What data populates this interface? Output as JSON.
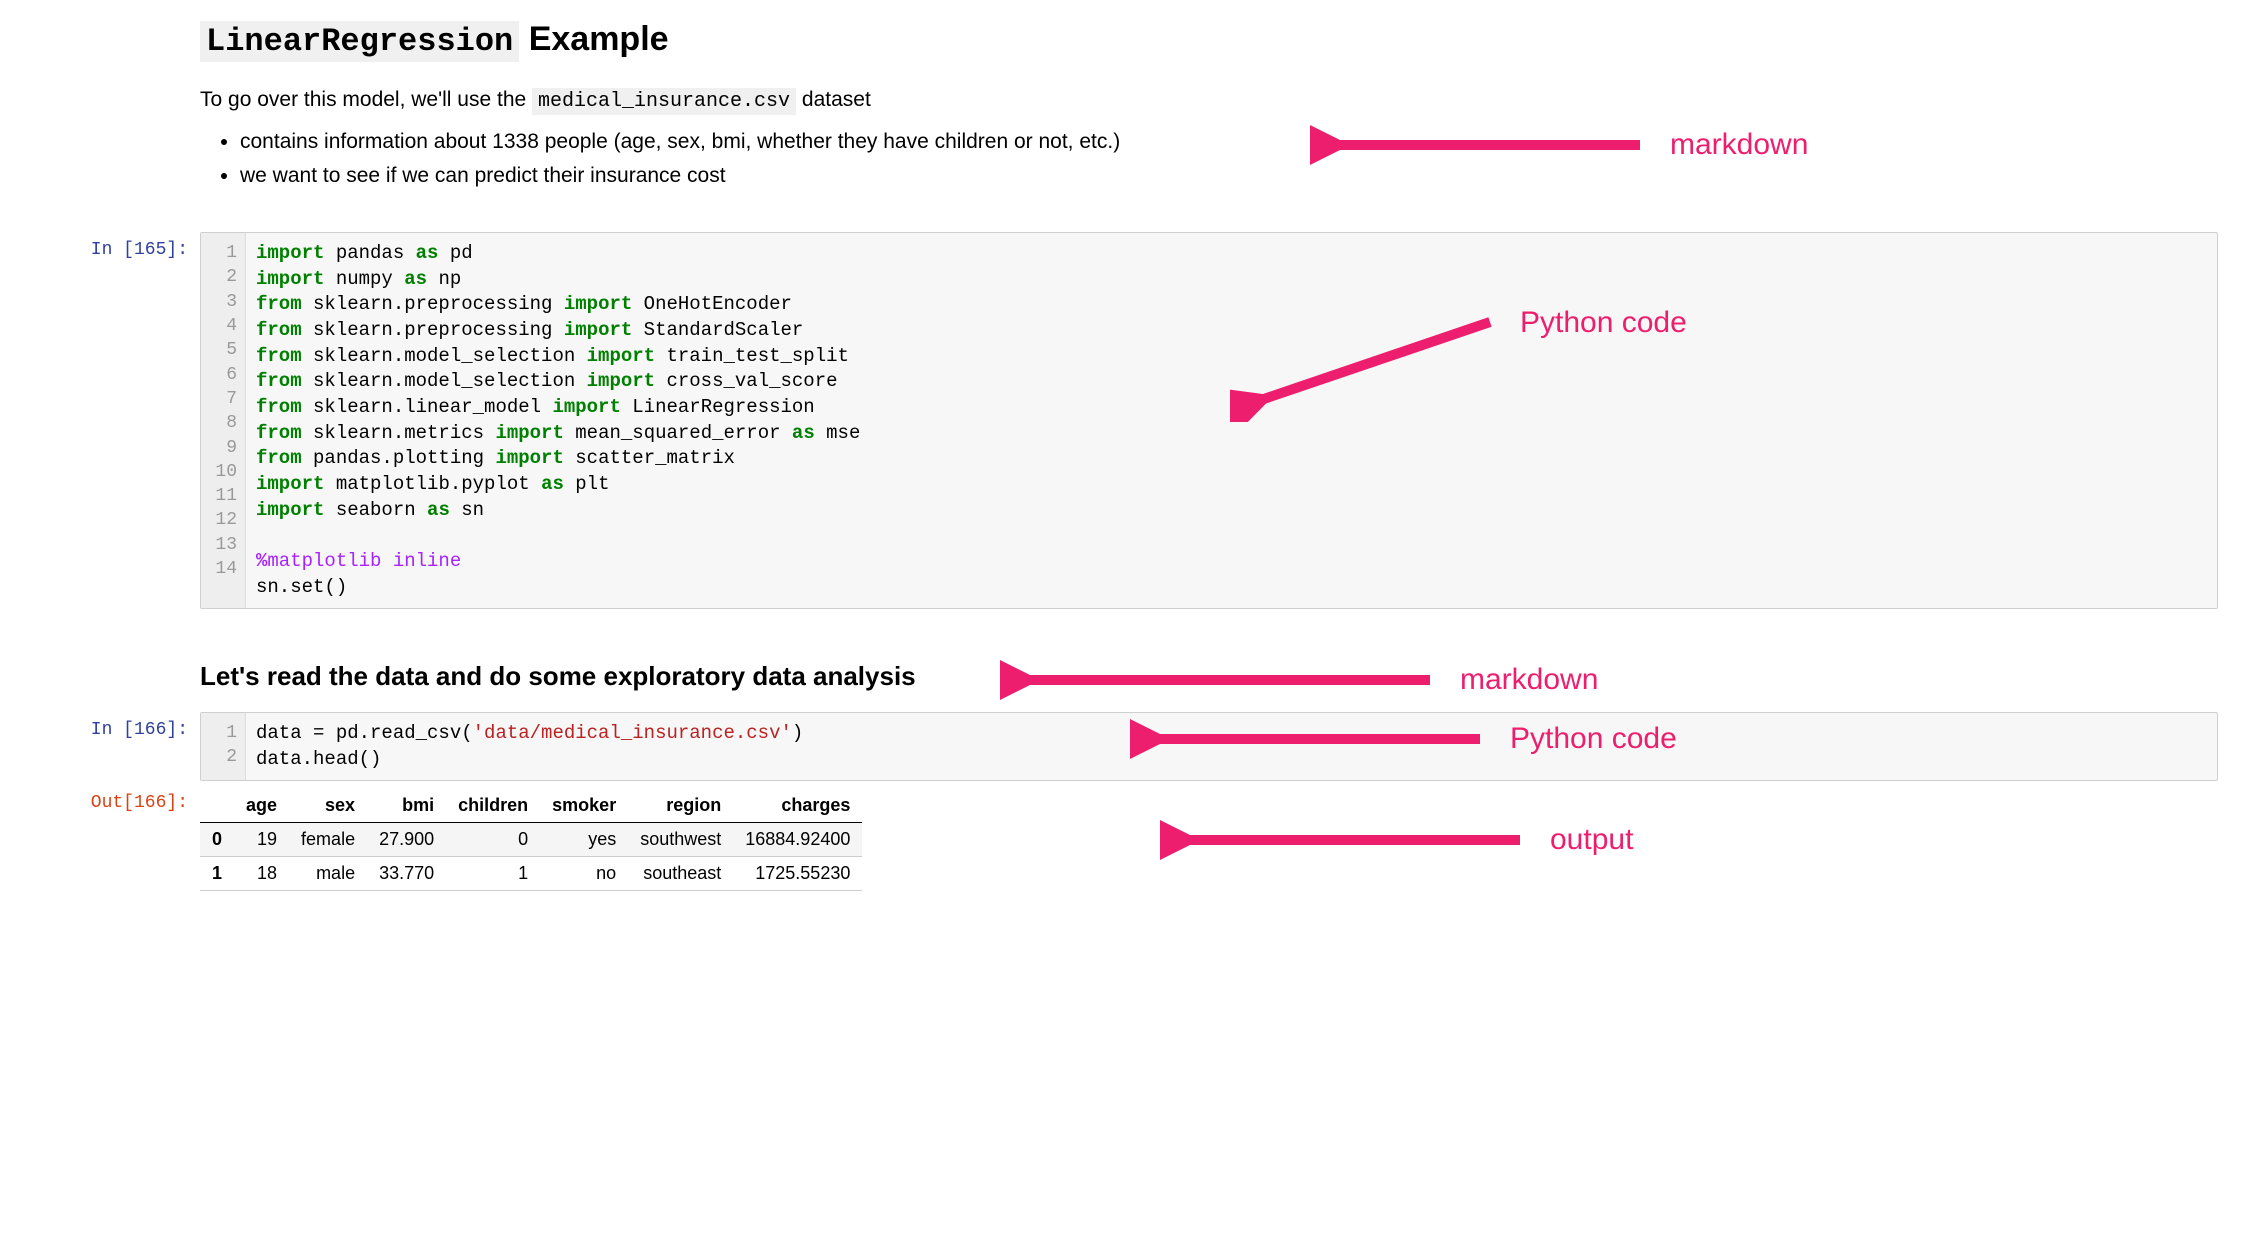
{
  "markdown1": {
    "title_code": "LinearRegression",
    "title_rest": " Example",
    "intro_pre": "To go over this model, we'll use the ",
    "intro_code": "medical_insurance.csv",
    "intro_post": " dataset",
    "bullets": [
      "contains information about 1338 people (age, sex, bmi, whether they have children or not, etc.)",
      "we want to see if we can predict their insurance cost"
    ]
  },
  "code1": {
    "prompt": "In [165]:",
    "line_count": 14,
    "lines": [
      {
        "t": [
          [
            "kw",
            "import"
          ],
          [
            "",
            " pandas "
          ],
          [
            "kw",
            "as"
          ],
          [
            "",
            " pd"
          ]
        ]
      },
      {
        "t": [
          [
            "kw",
            "import"
          ],
          [
            "",
            " numpy "
          ],
          [
            "kw",
            "as"
          ],
          [
            "",
            " np"
          ]
        ]
      },
      {
        "t": [
          [
            "kw",
            "from"
          ],
          [
            "",
            " sklearn.preprocessing "
          ],
          [
            "kw",
            "import"
          ],
          [
            "",
            " OneHotEncoder"
          ]
        ]
      },
      {
        "t": [
          [
            "kw",
            "from"
          ],
          [
            "",
            " sklearn.preprocessing "
          ],
          [
            "kw",
            "import"
          ],
          [
            "",
            " StandardScaler"
          ]
        ]
      },
      {
        "t": [
          [
            "kw",
            "from"
          ],
          [
            "",
            " sklearn.model_selection "
          ],
          [
            "kw",
            "import"
          ],
          [
            "",
            " train_test_split"
          ]
        ]
      },
      {
        "t": [
          [
            "kw",
            "from"
          ],
          [
            "",
            " sklearn.model_selection "
          ],
          [
            "kw",
            "import"
          ],
          [
            "",
            " cross_val_score"
          ]
        ]
      },
      {
        "t": [
          [
            "kw",
            "from"
          ],
          [
            "",
            " sklearn.linear_model "
          ],
          [
            "kw",
            "import"
          ],
          [
            "",
            " LinearRegression"
          ]
        ]
      },
      {
        "t": [
          [
            "kw",
            "from"
          ],
          [
            "",
            " sklearn.metrics "
          ],
          [
            "kw",
            "import"
          ],
          [
            "",
            " mean_squared_error "
          ],
          [
            "kw",
            "as"
          ],
          [
            "",
            " mse"
          ]
        ]
      },
      {
        "t": [
          [
            "kw",
            "from"
          ],
          [
            "",
            " pandas.plotting "
          ],
          [
            "kw",
            "import"
          ],
          [
            "",
            " scatter_matrix"
          ]
        ]
      },
      {
        "t": [
          [
            "kw",
            "import"
          ],
          [
            "",
            " matplotlib.pyplot "
          ],
          [
            "kw",
            "as"
          ],
          [
            "",
            " plt"
          ]
        ]
      },
      {
        "t": [
          [
            "kw",
            "import"
          ],
          [
            "",
            " seaborn "
          ],
          [
            "kw",
            "as"
          ],
          [
            "",
            " sn"
          ]
        ]
      },
      {
        "t": [
          [
            "",
            ""
          ]
        ]
      },
      {
        "t": [
          [
            "op",
            "%"
          ],
          [
            "magic",
            "matplotlib inline"
          ]
        ]
      },
      {
        "t": [
          [
            "",
            "sn.set()"
          ]
        ]
      }
    ]
  },
  "markdown2": {
    "heading": "Let's read the data and do some exploratory data analysis"
  },
  "code2": {
    "prompt": "In [166]:",
    "line_count": 2,
    "lines": [
      {
        "t": [
          [
            "",
            "data = pd.read_csv("
          ],
          [
            "str",
            "'data/medical_insurance.csv'"
          ],
          [
            "",
            ")"
          ]
        ]
      },
      {
        "t": [
          [
            "",
            "data.head()"
          ]
        ]
      }
    ]
  },
  "output2": {
    "prompt": "Out[166]:",
    "columns": [
      "",
      "age",
      "sex",
      "bmi",
      "children",
      "smoker",
      "region",
      "charges"
    ],
    "rows": [
      [
        "0",
        "19",
        "female",
        "27.900",
        "0",
        "yes",
        "southwest",
        "16884.92400"
      ],
      [
        "1",
        "18",
        "male",
        "33.770",
        "1",
        "no",
        "southeast",
        "1725.55230"
      ]
    ]
  },
  "annotations": {
    "a1": "markdown",
    "a2": "Python code",
    "a3": "markdown",
    "a4": "Python code",
    "a5": "output"
  },
  "arrow_color": "#ed1e6e"
}
